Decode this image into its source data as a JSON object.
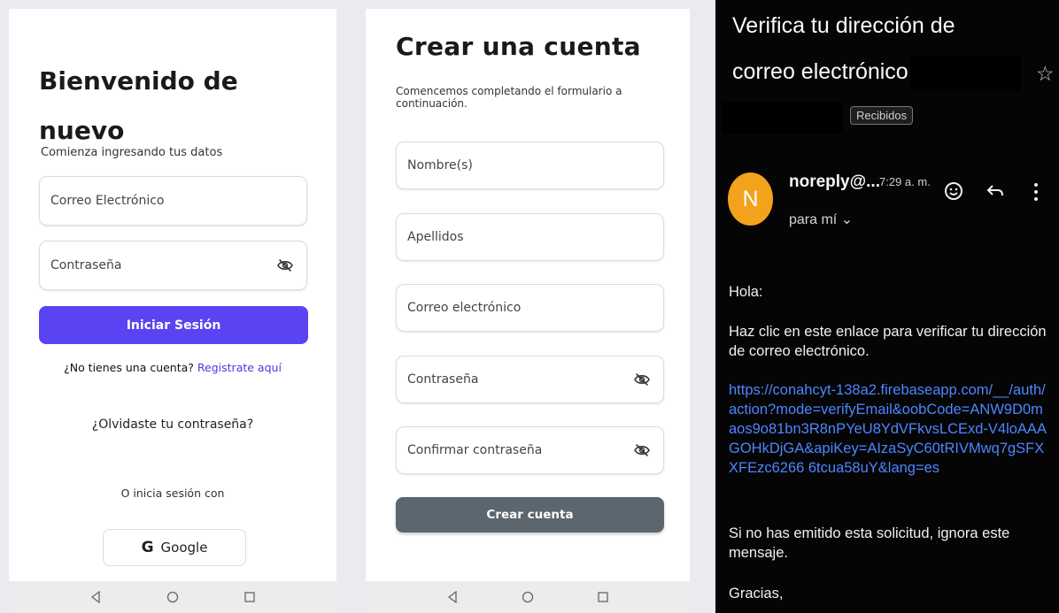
{
  "login": {
    "title": "Bienvenido de nuevo",
    "subtitle": "Comienza ingresando tus datos",
    "email_placeholder": "Correo Electrónico",
    "password_placeholder": "Contraseña",
    "submit": "Iniciar Sesión",
    "no_account": "¿No tienes una cuenta?",
    "register_link": "Registrate aquí",
    "forgot": "¿Olvidaste tu contraseña?",
    "or_login_with": "O inicia sesión con",
    "google": "Google",
    "google_letter": "G"
  },
  "register": {
    "title": "Crear una cuenta",
    "subtitle": "Comencemos completando el formulario a continuación.",
    "fields": [
      {
        "label": "Nombre(s)"
      },
      {
        "label": "Apellidos"
      },
      {
        "label": "Correo electrónico"
      },
      {
        "label": "Contraseña"
      },
      {
        "label": "Confirmar contraseña"
      }
    ],
    "submit": "Crear cuenta"
  },
  "email": {
    "subject_line1": "Verifica tu dirección de",
    "subject_line2": "correo electrónico",
    "label": "Recibidos",
    "avatar_letter": "N",
    "sender": "noreply@...",
    "time": "7:29 a. m.",
    "to": "para mí ⌄",
    "greeting": "Hola:",
    "instructions": "Haz clic en este enlace para verificar tu dirección de correo electrónico.",
    "link": "https://conahcyt-138a2.firebaseapp.com/__/auth/action?mode=verifyEmail&oobCode=ANW9D0maos9o81bn3R8nPYeU8YdVFkvsLCExd-V4loAAAGOHkDjGA&apiKey=AIzaSyC60tRIVMwq7gSFXXFEzc6266 6tcua58uY&lang=es",
    "ignore": "Si no has emitido esta solicitud, ignora este mensaje.",
    "thanks": "Gracias,"
  },
  "colors": {
    "primary": "#5a44f2",
    "secondary": "#5b666f",
    "link": "#4d86ff",
    "avatar": "#f3a21c"
  }
}
